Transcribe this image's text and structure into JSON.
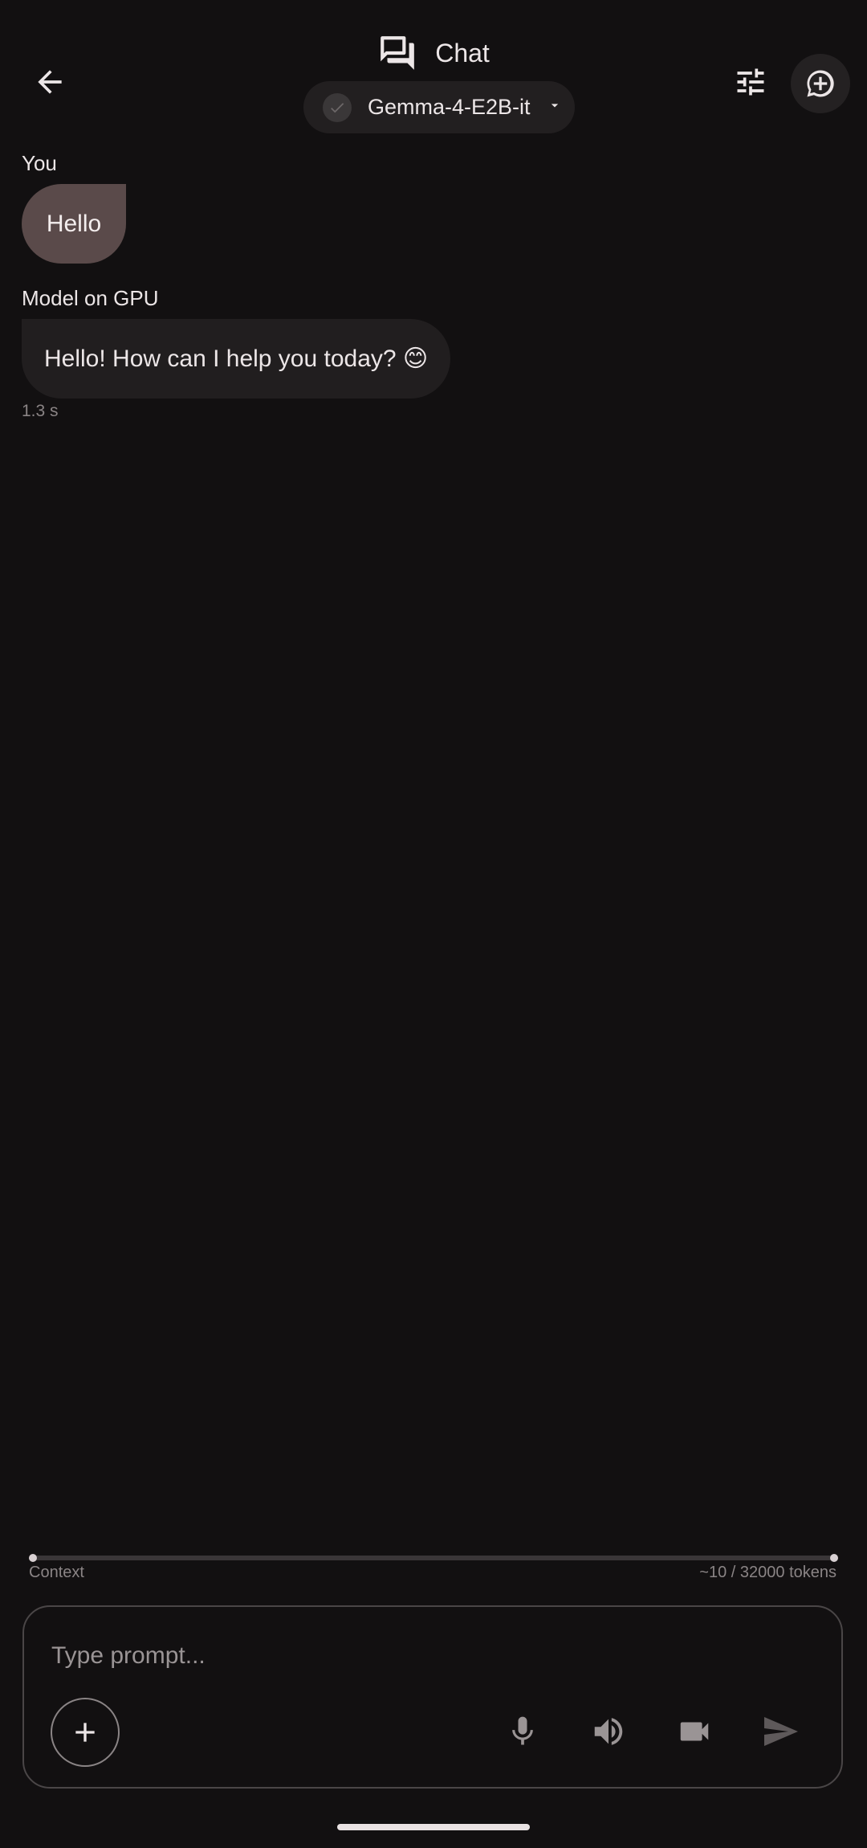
{
  "header": {
    "title": "Chat",
    "model_name": "Gemma-4-E2B-it",
    "icons": {
      "back": "arrow-left-icon",
      "title": "chat-bubbles-icon",
      "model_status": "check-circle-icon",
      "model_dropdown": "caret-down-icon",
      "settings": "tune-sliders-icon",
      "new_chat": "add-comment-icon"
    }
  },
  "messages": [
    {
      "sender": "You",
      "text": "Hello"
    },
    {
      "sender": "Model on GPU",
      "text": "Hello! How can I help you today? 😊",
      "latency": "1.3 s"
    }
  ],
  "context": {
    "label": "Context",
    "tokens": "~10 / 32000 tokens",
    "used_fraction": 0.0003
  },
  "input": {
    "placeholder": "Type prompt...",
    "icons": {
      "add": "plus-icon",
      "mic": "microphone-icon",
      "speaker": "speaker-icon",
      "video": "video-camera-icon",
      "send": "send-icon"
    }
  },
  "colors": {
    "background": "#121011",
    "user_bubble": "#5a4a4a",
    "model_bubble": "#211e1f",
    "muted_text": "#8a8485"
  }
}
